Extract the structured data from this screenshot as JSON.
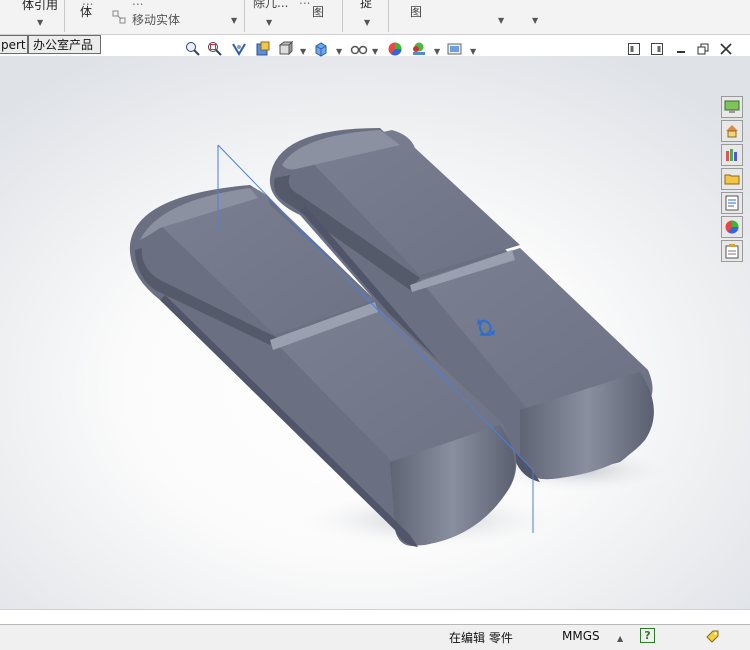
{
  "ribbon": {
    "item1": "体引用",
    "item2a": "...",
    "item2b": "体",
    "item3a": "...",
    "item3b": "移动实体",
    "item4": "除几...",
    "item5a": "...",
    "item5b": "图",
    "item6": "捉",
    "item7": "图"
  },
  "tabs": [
    "pert",
    "办公室产品"
  ],
  "status": {
    "editing": "在编辑 零件",
    "units": "MMGS",
    "help": "?"
  },
  "colors": {
    "part_body": "#757a8c",
    "plane": "#4d7fd6"
  }
}
